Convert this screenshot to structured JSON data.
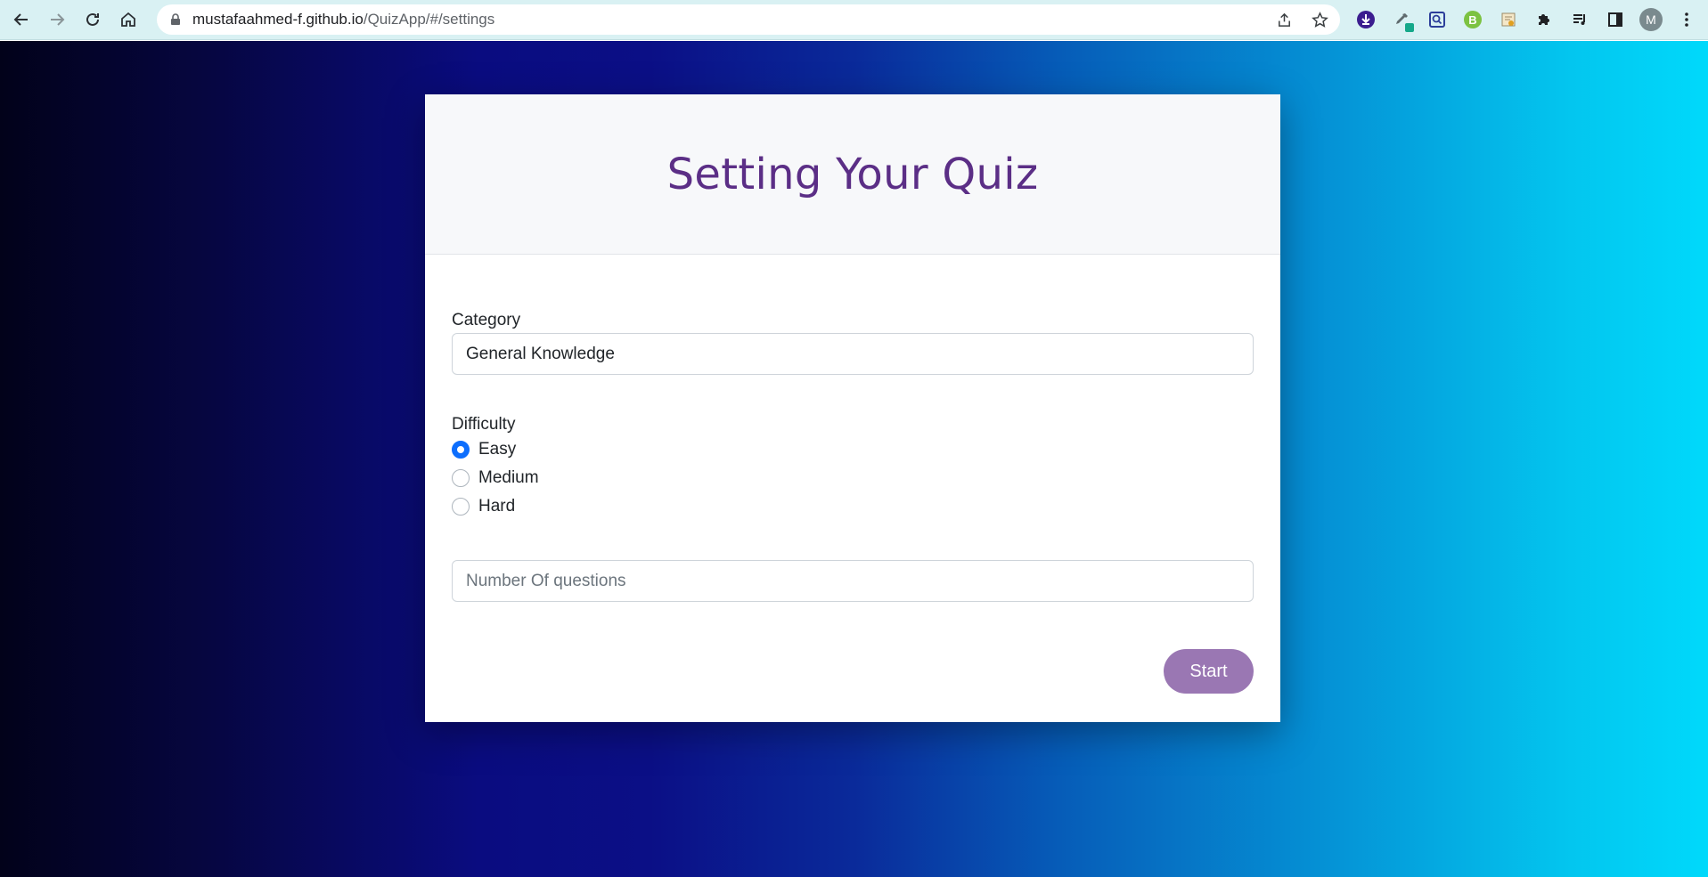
{
  "browser": {
    "url_host": "mustafaahmed-f.github.io",
    "url_path": "/QuizApp/#/settings",
    "avatar_letter": "M",
    "ext_b_letter": "B",
    "icons": [
      "back-icon",
      "forward-icon",
      "reload-icon",
      "home-icon",
      "lock-icon",
      "share-icon",
      "star-icon",
      "download-ext-icon",
      "eyedropper-ext-icon",
      "search-ext-icon",
      "b-ext-icon",
      "page-ext-icon",
      "puzzle-icon",
      "media-icon",
      "sidepanel-icon",
      "menu-icon"
    ]
  },
  "quiz": {
    "title": "Setting Your Quiz",
    "category_label": "Category",
    "category_value": "General Knowledge",
    "difficulty_label": "Difficulty",
    "difficulty_options": [
      {
        "label": "Easy",
        "checked": true
      },
      {
        "label": "Medium",
        "checked": false
      },
      {
        "label": "Hard",
        "checked": false
      }
    ],
    "questions_placeholder": "Number Of questions",
    "start_label": "Start"
  },
  "colors": {
    "title": "#5b2e86",
    "button": "#9a77b3",
    "radio_checked": "#0d6efd",
    "gradient_left": "#02021a",
    "gradient_mid": "#0b0f86",
    "gradient_right": "#00d9fb"
  }
}
